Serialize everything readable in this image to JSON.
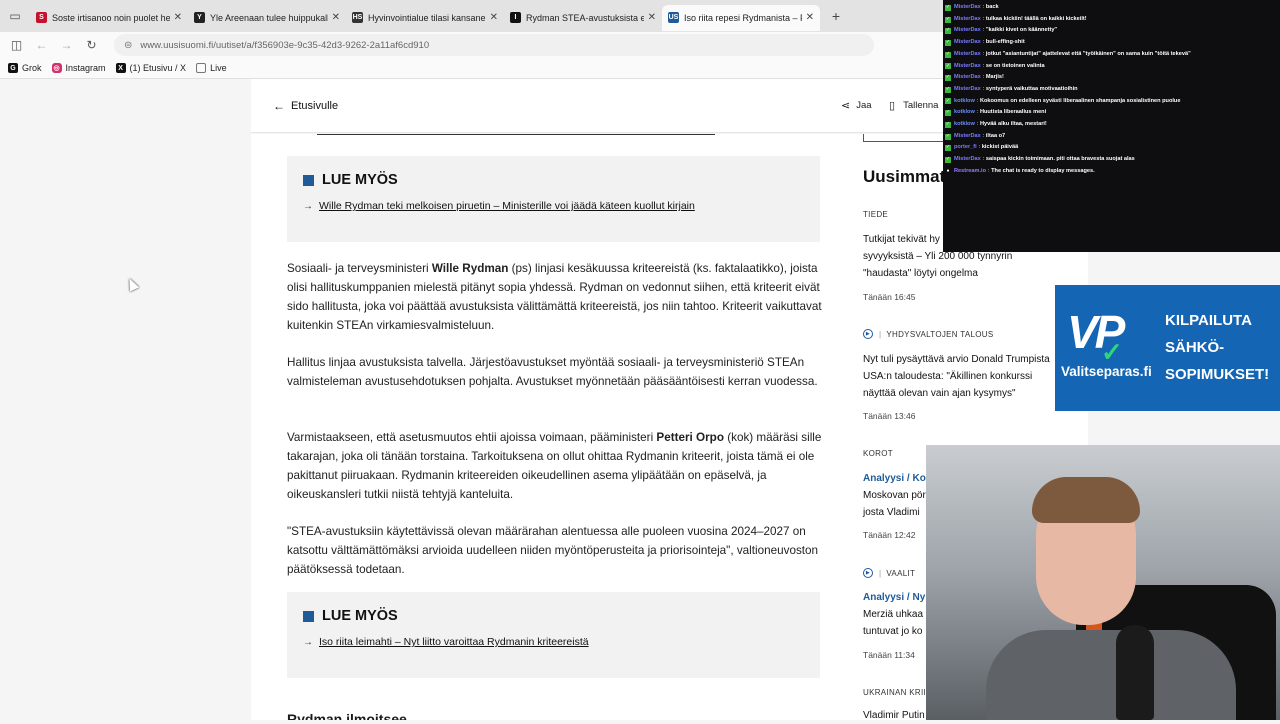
{
  "browser": {
    "tabs": [
      {
        "title": "Soste irtisanoo noin puolet henk",
        "favicon": "S",
        "color": "#c8102e"
      },
      {
        "title": "Yle Areenaan tulee huippukalliste",
        "favicon": "Y",
        "color": "#222222"
      },
      {
        "title": "Hyvinvointialue tilasi kansanedu",
        "favicon": "HS",
        "color": "#333333"
      },
      {
        "title": "Rydman STEA-avustuksista eten",
        "favicon": "I",
        "color": "#111111"
      },
      {
        "title": "Iso riita repesi Rydmanista – Pet",
        "favicon": "US",
        "color": "#1f5b98",
        "active": true
      }
    ],
    "url": "www.uusisuomi.fi/uutiset/a/f356903e-9c35-42d3-9262-2a11af6cd910",
    "bookmarks": [
      "Grok",
      "Instagram",
      "(1) Etusivu / X",
      "Live"
    ]
  },
  "header": {
    "back_label": "Etusivulle",
    "share_label": "Jaa",
    "save_label": "Tallenna"
  },
  "article": {
    "read_also_1": {
      "heading": "LUE MYÖS",
      "link": "Wille Rydman teki melkoisen piruetin – Ministerille voi jäädä käteen kuollut kirjain"
    },
    "p1_a": "Sosiaali- ja terveysministeri ",
    "p1_b": "Wille Rydman",
    "p1_c": " (ps) linjasi kesäkuussa kriteereistä (ks. faktalaatikko), joista olisi hallituskumppanien mielestä pitänyt sopia yhdessä. Rydman on vedonnut siihen, että kriteerit eivät sido hallitusta, joka voi päättää avustuksista välittämättä kriteereistä, jos niin tahtoo. Kriteerit vaikuttavat kuitenkin STEAn virkamiesvalmisteluun.",
    "p2": "Hallitus linjaa avustuksista talvella. Järjestöavustukset myöntää sosiaali- ja terveysministeriö STEAn valmisteleman avustusehdotuksen pohjalta. Avustukset myönnetään pääsääntöisesti kerran vuodessa.",
    "p3_a": "Varmistaakseen, että asetusmuutos ehtii ajoissa voimaan, pääministeri ",
    "p3_b": "Petteri Orpo",
    "p3_c": " (kok) määräsi sille takarajan, joka oli tänään torstaina. Tarkoituksena on ollut ohittaa Rydmanin kriteerit, joista tämä ei ole pakittanut piiruakaan. Rydmanin kriteereiden oikeudellinen asema ylipäätään on epäselvä, ja oikeuskansleri tutkii niistä tehtyjä kanteluita.",
    "p4": "\"STEA-avustuksiin käytettävissä olevan määrärahan alentuessa alle puoleen vuosina 2024–2027 on katsottu välttämättömäksi arvioida uudelleen niiden myöntöperusteita ja priorisointeja\", valtioneuvoston päätöksessä todetaan.",
    "read_also_2": {
      "heading": "LUE MYÖS",
      "link": "Iso riita leimahti – Nyt liitto varoittaa Rydmanin kriteereistä"
    },
    "subhead": "Rydman ilmoitsee"
  },
  "sidebar": {
    "title": "Uusimmat",
    "items": [
      {
        "category": "TIEDE",
        "text": "Tutkijat tekivät hy... syvyyksistä – Yli 200 000 tynnyrin \"haudasta\" löytyi ongelma",
        "line1": "Tutkijat tekivät hy",
        "line2": "syvyyksistä – Yli 200 000 tynnyrin",
        "line3": "\"haudasta\" löytyi ongelma",
        "time": "Tänään 16:45"
      },
      {
        "category": "YHDYSVALTOJEN TALOUS",
        "line1": "Nyt tuli pysäyttävä arvio Donald Trumpista",
        "line2": "USA:n taloudesta: \"Äkillinen konkurssi",
        "line3": "näyttää olevan vain ajan kysymys\"",
        "time": "Tänään 13:46"
      },
      {
        "category": "KOROT",
        "line1_prefix": "Analyysi / ",
        "line1": "Ko",
        "line2": "Moskovan pör",
        "line3": "josta Vladimi",
        "time": "Tänään 12:42"
      },
      {
        "category": "VAALIT",
        "line1_prefix": "Analyysi / ",
        "line1": "Ny",
        "line2": "Merziä uhkaa",
        "line3": "tuntuvat jo ko",
        "time": "Tänään 11:34"
      },
      {
        "category": "UKRAINAN KRII",
        "line1": "Vladimir Putin"
      }
    ]
  },
  "chat": {
    "messages": [
      {
        "user": "MisterDax",
        "text": "back",
        "color": "#7b7bff"
      },
      {
        "user": "MisterDax",
        "text": "tulkaa kickiin! täällä on kaikki kickeilt!",
        "color": "#7b7bff"
      },
      {
        "user": "MisterDax",
        "text": "\"kaikki kivet on käännetty\"",
        "color": "#7b7bff"
      },
      {
        "user": "MisterDax",
        "text": "bull-effing-shit",
        "color": "#7b7bff"
      },
      {
        "user": "MisterDax",
        "text": "jotkut \"asiantuntijat\" ajattelevat että \"työikäinen\" on sama kuin \"töitä tekevä\"",
        "color": "#7b7bff"
      },
      {
        "user": "MisterDax",
        "text": "se on tietoinen valinta",
        "color": "#7b7bff"
      },
      {
        "user": "MisterDax",
        "text": "Marjis!",
        "color": "#7b7bff"
      },
      {
        "user": "MisterDax",
        "text": "syntyperä vaikuttaa motivaatioihin",
        "color": "#7b7bff"
      },
      {
        "user": "kotklow",
        "text": "Kokoomus on edelleen syvästi liberaalinen shampanja sosialistinen puolue",
        "color": "#6d8cff"
      },
      {
        "user": "kotklow",
        "text": "Huutista liberaalius meni",
        "color": "#6d8cff"
      },
      {
        "user": "kotklow",
        "text": "Hyvää alku iltaa, mestari!",
        "color": "#6d8cff"
      },
      {
        "user": "MisterDax",
        "text": "iltaa o7",
        "color": "#7b7bff"
      },
      {
        "user": "porter_fi",
        "text": "kickist päivää",
        "color": "#7b7bff"
      },
      {
        "user": "MisterDax",
        "text": "saispaa kickin toimimaan. piti ottaa bravesta suojat alas",
        "color": "#7b7bff"
      },
      {
        "user": "Restream.io",
        "text": "The chat is ready to display messages.",
        "color": "#9b7bff",
        "system": true
      }
    ]
  },
  "ad": {
    "logo": "VP",
    "site": "Valitseparas.fi",
    "slogan_1": "KILPAILUTA",
    "slogan_2": "SÄHKÖ-",
    "slogan_3": "SOPIMUKSET!"
  }
}
